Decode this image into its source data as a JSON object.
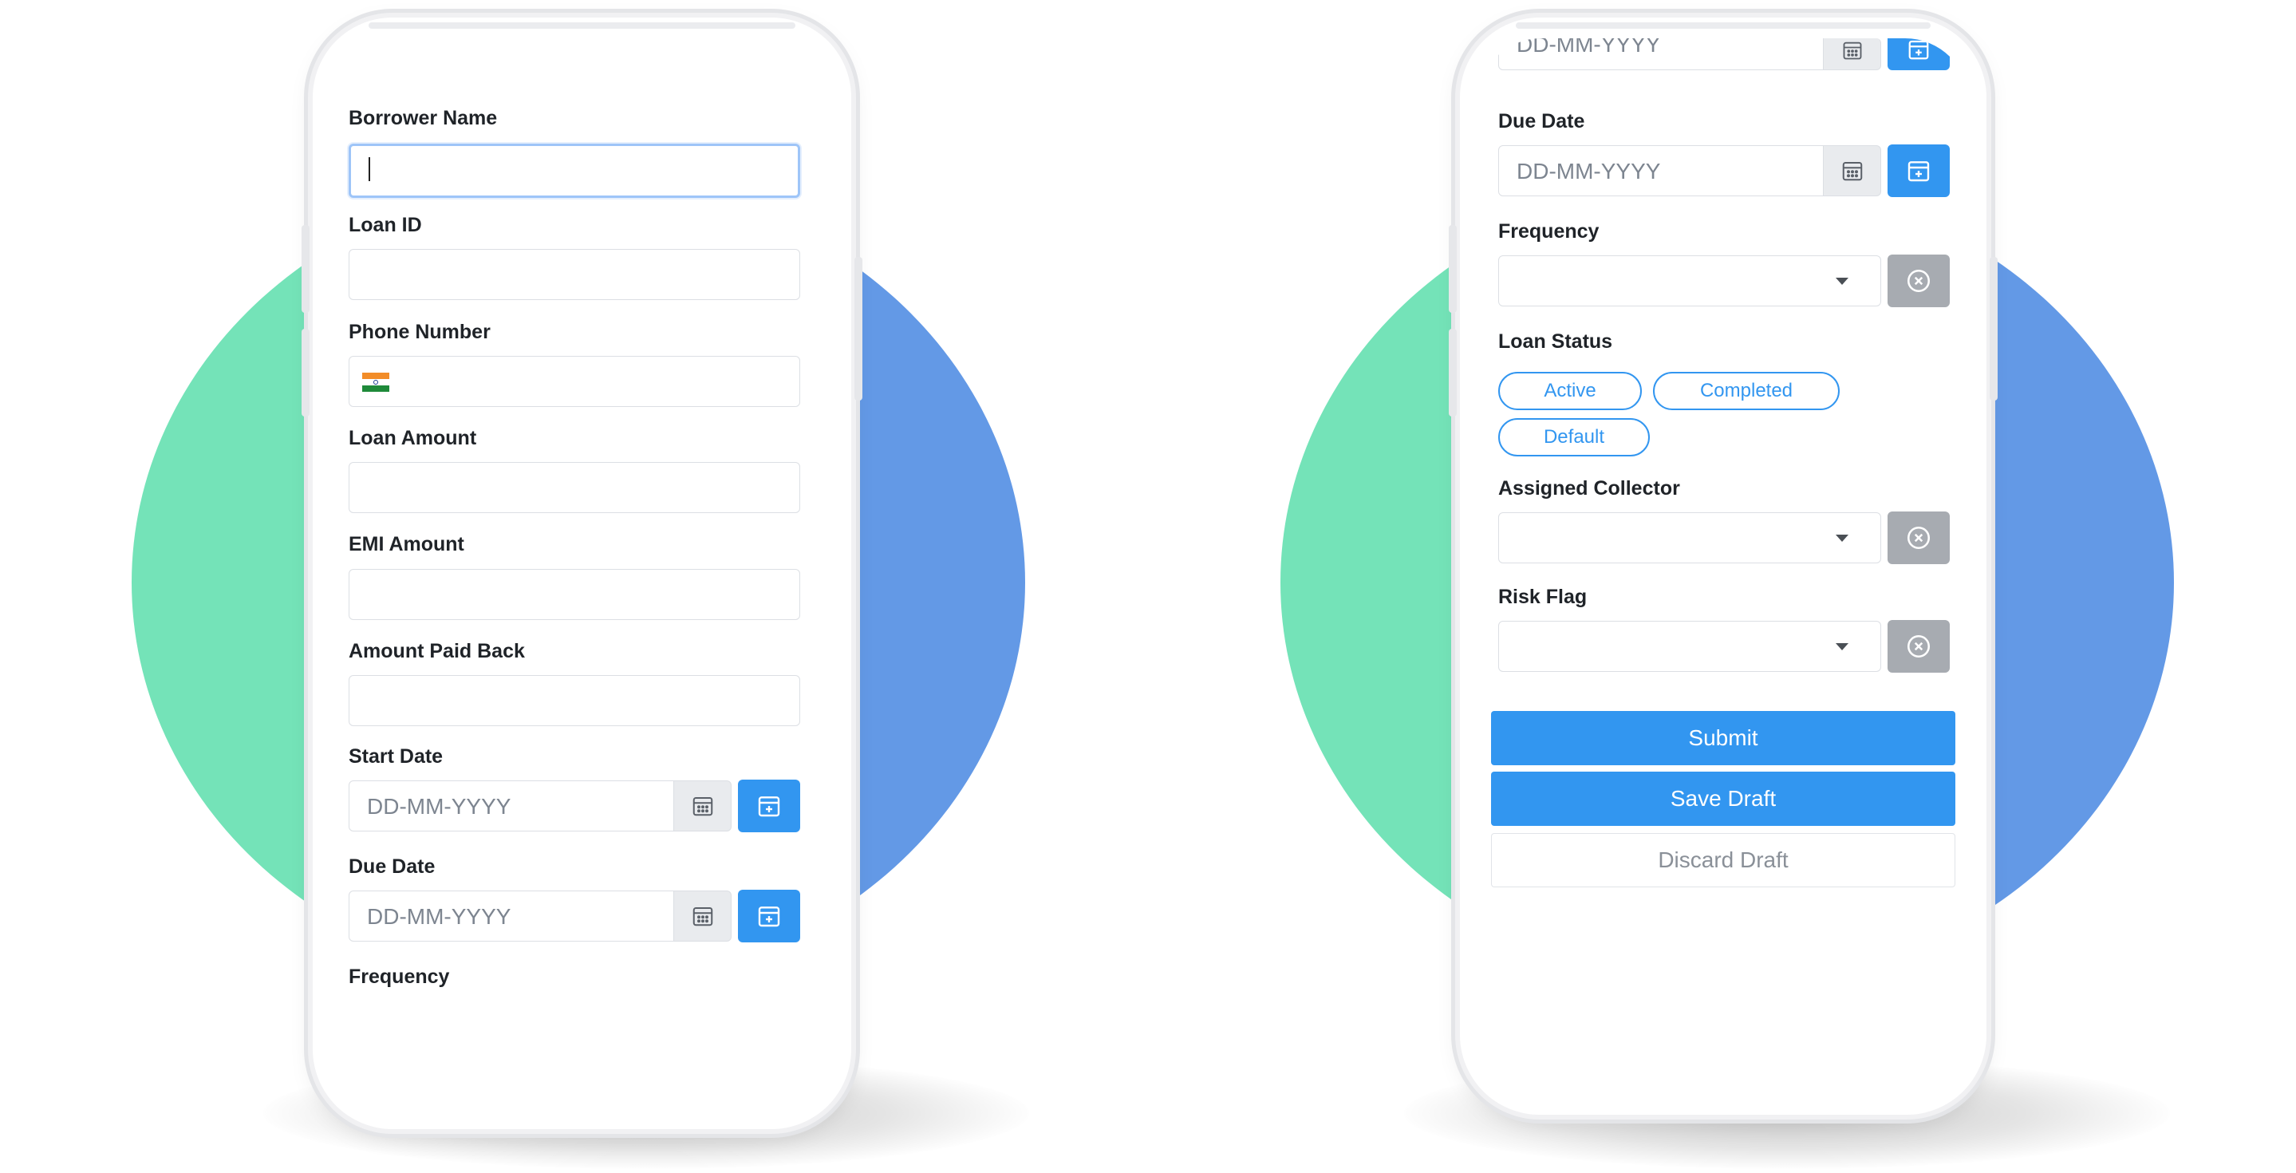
{
  "left_form": {
    "borrower_name_label": "Borrower Name",
    "loan_id_label": "Loan ID",
    "phone_number_label": "Phone Number",
    "loan_amount_label": "Loan Amount",
    "emi_amount_label": "EMI Amount",
    "amount_paid_back_label": "Amount Paid Back",
    "start_date_label": "Start Date",
    "start_date_placeholder": "DD-MM-YYYY",
    "due_date_label": "Due Date",
    "due_date_placeholder": "DD-MM-YYYY",
    "frequency_label": "Frequency",
    "phone_flag": "india-flag-icon"
  },
  "right_form": {
    "start_date_placeholder": "DD-MM-YYYY",
    "due_date_label": "Due Date",
    "due_date_placeholder": "DD-MM-YYYY",
    "frequency_label": "Frequency",
    "loan_status_label": "Loan Status",
    "loan_status_options": [
      "Active",
      "Completed",
      "Default"
    ],
    "assigned_collector_label": "Assigned Collector",
    "risk_flag_label": "Risk Flag",
    "submit_label": "Submit",
    "save_draft_label": "Save Draft",
    "discard_draft_label": "Discard Draft"
  },
  "icons": {
    "calendar": "calendar-icon",
    "calendar_add": "calendar-add-icon",
    "clear": "clear-circle-x-icon",
    "dropdown": "chevron-down-icon"
  },
  "colors": {
    "accent_blue": "#3296f0",
    "circle_green": "#74e3b8",
    "circle_blue": "#6399e6",
    "clear_button_gray": "#a7abb1"
  }
}
